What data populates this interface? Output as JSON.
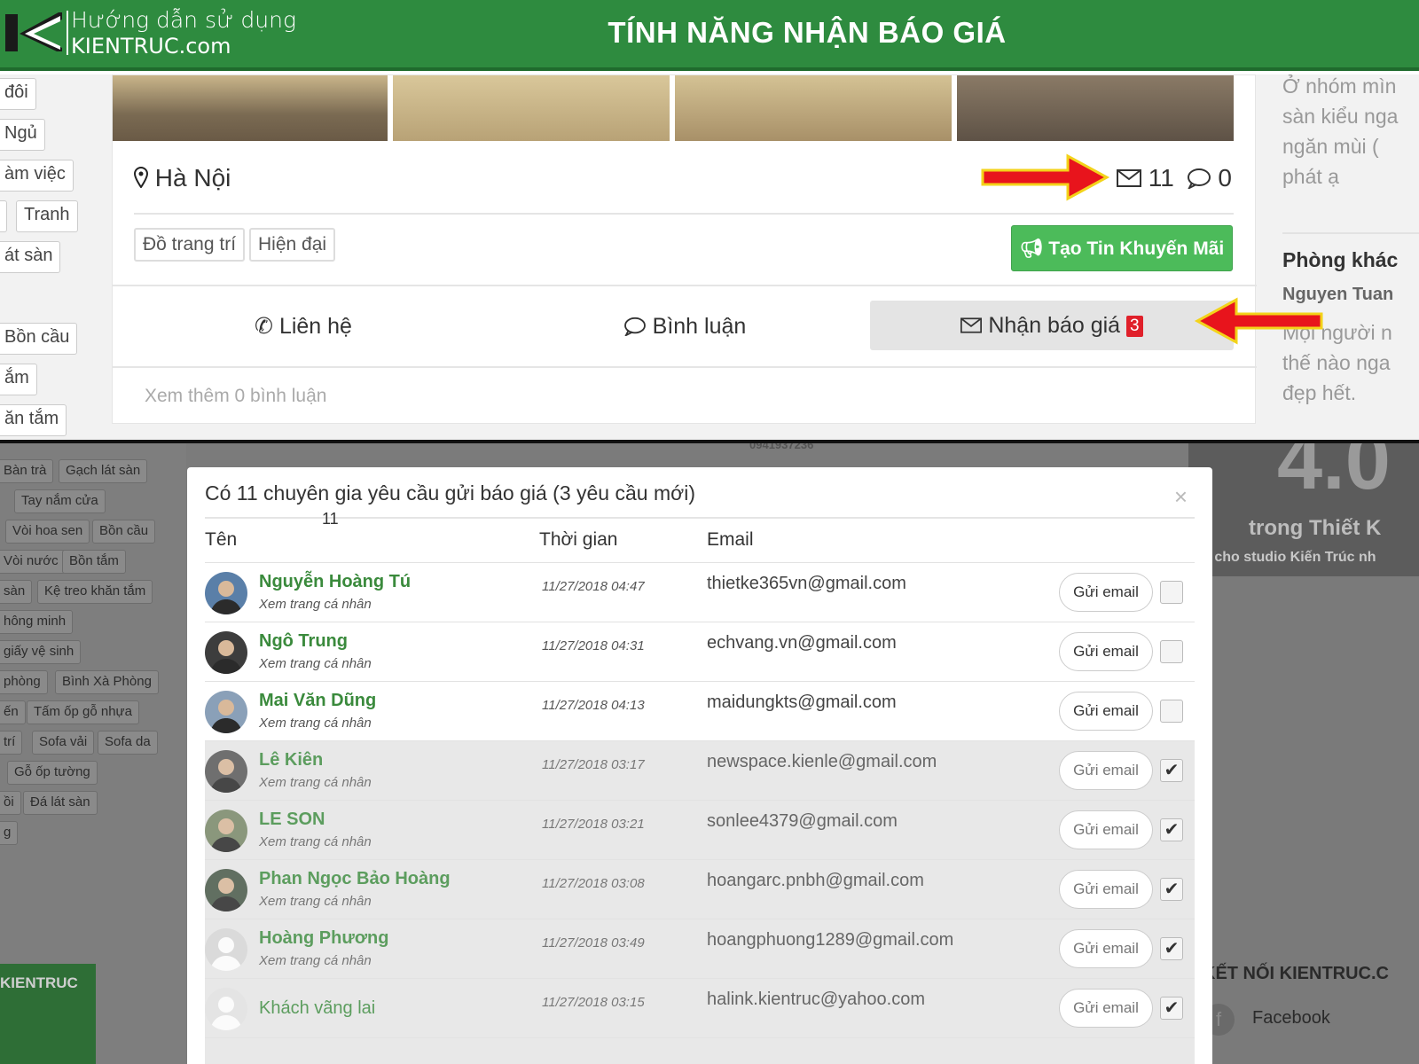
{
  "banner": {
    "brand_line1": "Hướng dẫn sử dụng",
    "brand_line2": "KIENTRUC.com",
    "title": "TÍNH NĂNG NHẬN BÁO GIÁ"
  },
  "top": {
    "left_tags": [
      "đôi",
      "Ngủ",
      "àm việc",
      "Tranh",
      "át sàn",
      "Bồn cầu",
      "ắm",
      "ăn tắm"
    ],
    "location": "Hà Nội",
    "mail_count": "11",
    "comment_count": "0",
    "tags": [
      "Đồ trang trí",
      "Hiện đại"
    ],
    "promo_button": "Tạo Tin Khuyến Mãi",
    "actions": {
      "contact": "Liên hệ",
      "comment": "Bình luận",
      "quote": "Nhận báo giá",
      "quote_badge": "3"
    },
    "more_comments": "Xem thêm 0 bình luận",
    "right_text": [
      "Ở nhóm mìn",
      "sàn kiểu nga",
      "ngăn mùi (",
      "phát ạ"
    ],
    "right_heading": "Phòng khác",
    "right_author": "Nguyen Tuan",
    "right_text2": [
      "Mọi người n",
      "thế nào nga",
      "đẹp hết."
    ]
  },
  "bottom": {
    "bg_tags": [
      [
        "Bàn trà",
        "Gạch lát sàn"
      ],
      [
        "Tay nắm cửa"
      ],
      [
        "Vòi hoa sen",
        "Bồn cầu"
      ],
      [
        "Vòi nước",
        "Bồn tắm"
      ],
      [
        "sàn",
        "Kệ treo khăn tắm"
      ],
      [
        "hông minh"
      ],
      [
        "giấy vệ sinh"
      ],
      [
        "phòng",
        "Bình Xà Phòng"
      ],
      [
        "ến",
        "Tấm ốp gỗ nhựa"
      ],
      [
        "trí",
        "Sofa vải",
        "Sofa da"
      ],
      [
        "Gỗ ốp tường"
      ],
      [
        "ồi",
        "Đá lát sàn"
      ],
      [
        "g"
      ]
    ],
    "bg_big_text": "4.0",
    "bg_sub_text": "trong Thiết K",
    "bg_sub_text2": "Vòi cho studio Kiến Trúc nh",
    "phone_fragment": "0941937236",
    "logo_fragment": "KIENTRUC",
    "connect_title": "KẾT NỐI KIENTRUC.C",
    "facebook": "Facebook"
  },
  "modal": {
    "title": "Có 11 chuyên gia yêu cầu gửi báo giá (3 yêu cầu mới)",
    "close": "×",
    "floating_count": "11",
    "headers": {
      "name": "Tên",
      "time": "Thời gian",
      "email": "Email"
    },
    "profile_link": "Xem trang cá nhân",
    "send_label": "Gửi email",
    "check_mark": "✔",
    "rows": [
      {
        "name": "Nguyễn Hoàng Tú",
        "time": "11/27/2018 04:47",
        "email": "thietke365vn@gmail.com",
        "checked": false
      },
      {
        "name": "Ngô Trung",
        "time": "11/27/2018 04:31",
        "email": "echvang.vn@gmail.com",
        "checked": false
      },
      {
        "name": "Mai Văn Dũng",
        "time": "11/27/2018 04:13",
        "email": "maidungkts@gmail.com",
        "checked": false
      },
      {
        "name": "Lê Kiên",
        "time": "11/27/2018 03:17",
        "email": "newspace.kienle@gmail.com",
        "checked": true
      },
      {
        "name": "LE SON",
        "time": "11/27/2018 03:21",
        "email": "sonlee4379@gmail.com",
        "checked": true
      },
      {
        "name": "Phan Ngọc Bảo Hoàng",
        "time": "11/27/2018 03:08",
        "email": "hoangarc.pnbh@gmail.com",
        "checked": true
      },
      {
        "name": "Hoàng Phương",
        "time": "11/27/2018 03:49",
        "email": "hoangphuong1289@gmail.com",
        "checked": true
      },
      {
        "name": "Khách vãng lai",
        "time": "11/27/2018 03:15",
        "email": "halink.kientruc@yahoo.com",
        "checked": true
      }
    ]
  },
  "colors": {
    "banner": "#2e8b3f",
    "promo": "#4cbb5a",
    "name_green": "#3a8a3c",
    "arrow_red": "#e8141c",
    "badge_red": "#e0202a"
  }
}
